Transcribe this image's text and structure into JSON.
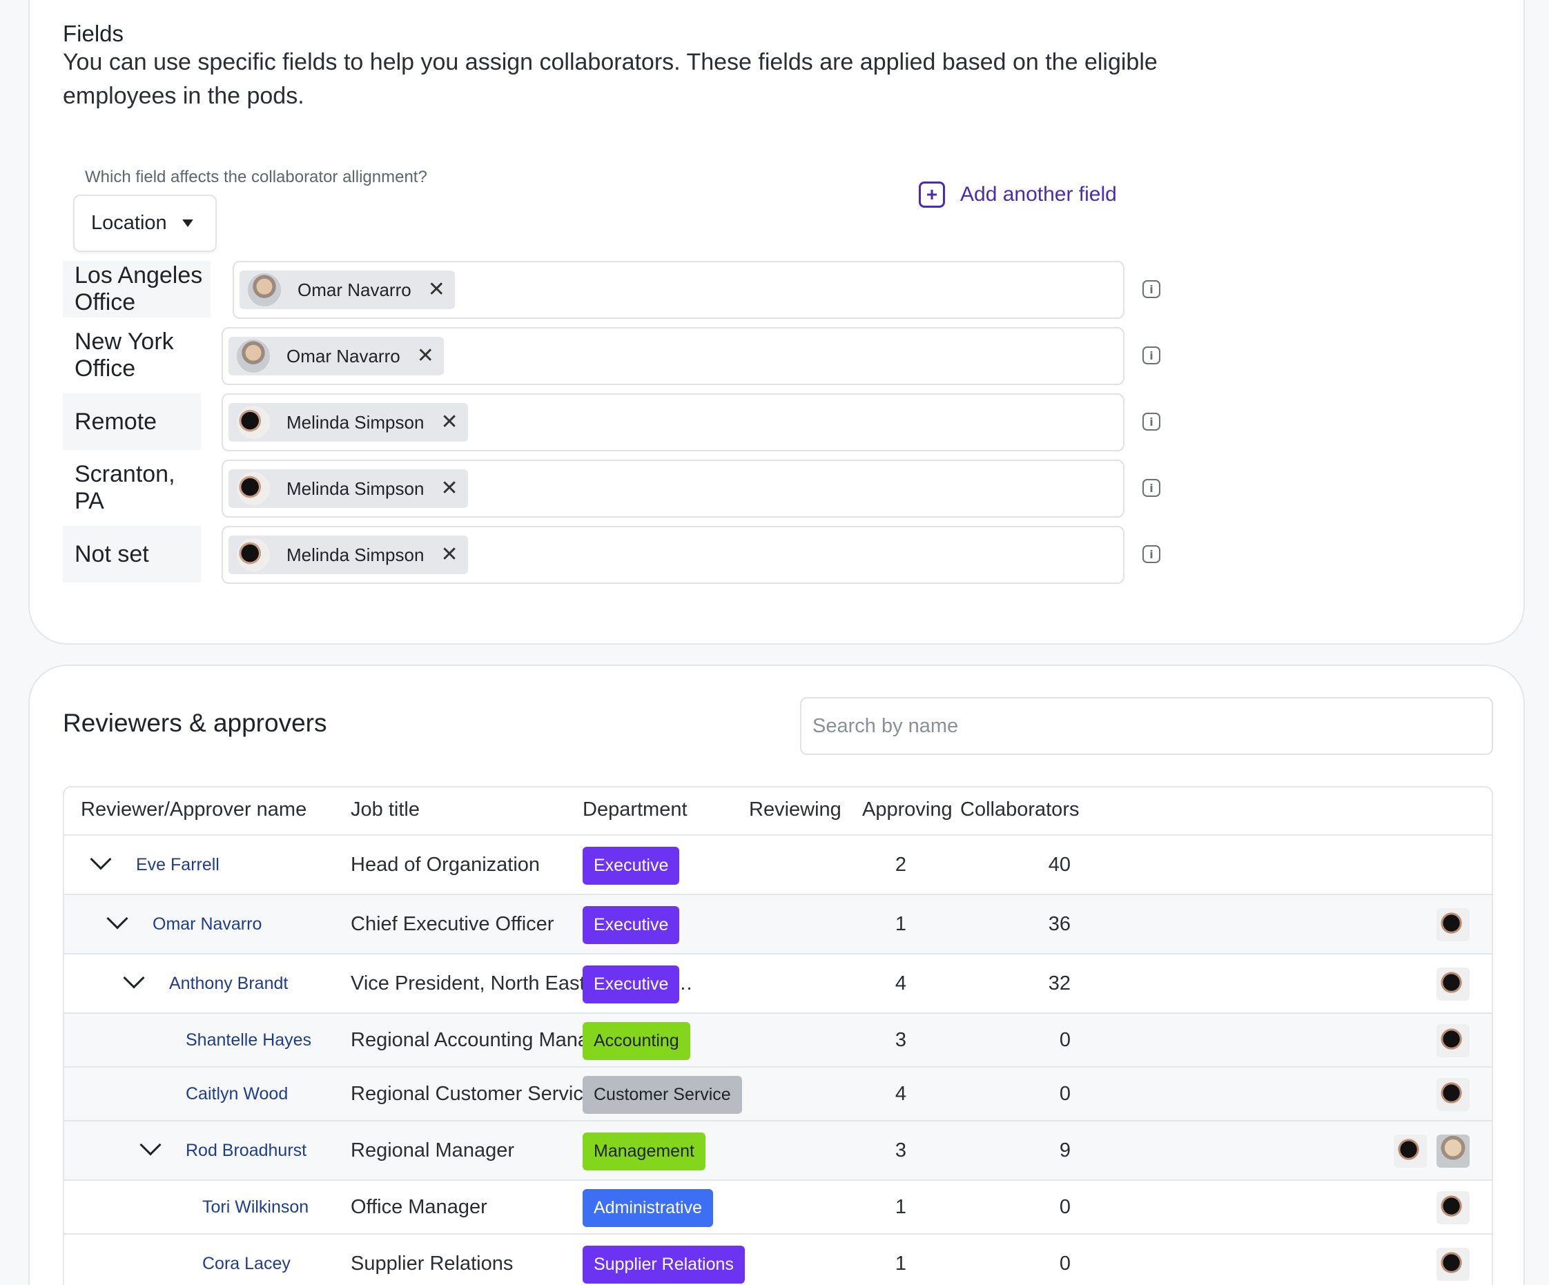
{
  "fields": {
    "title": "Fields",
    "description": "You can use specific fields to help you assign collaborators. These fields are applied based on the eligible employees in the pods.",
    "question": "Which field affects the collaborator allignment?",
    "selected_field": "Location",
    "add_field_label": "Add another field",
    "locations": [
      {
        "label": "Los Angeles Office",
        "collaborator": "Omar Navarro",
        "avatar": "omar"
      },
      {
        "label": "New York Office",
        "collaborator": "Omar Navarro",
        "avatar": "omar"
      },
      {
        "label": "Remote",
        "collaborator": "Melinda Simpson",
        "avatar": "melinda"
      },
      {
        "label": "Scranton, PA",
        "collaborator": "Melinda Simpson",
        "avatar": "melinda"
      },
      {
        "label": "Not set",
        "collaborator": "Melinda Simpson",
        "avatar": "melinda"
      }
    ]
  },
  "reviewers": {
    "title": "Reviewers & approvers",
    "search_placeholder": "Search by name",
    "columns": {
      "name": "Reviewer/Approver name",
      "job": "Job title",
      "department": "Department",
      "reviewing": "Reviewing",
      "approving": "Approving",
      "collaborators": "Collaborators"
    },
    "rows": [
      {
        "name": "Eve Farrell",
        "job": "Head of Organization",
        "department": "Executive",
        "reviewing": "2",
        "approving": "40",
        "expandable": true,
        "level": 0,
        "collaborators": []
      },
      {
        "name": "Omar Navarro",
        "job": "Chief Executive Officer",
        "department": "Executive",
        "reviewing": "1",
        "approving": "36",
        "expandable": true,
        "level": 1,
        "collaborators": [
          "melinda"
        ]
      },
      {
        "name": "Anthony Brandt",
        "job": "Vice President, North East Region &…",
        "department": "Executive",
        "reviewing": "4",
        "approving": "32",
        "expandable": true,
        "level": 2,
        "collaborators": [
          "melinda"
        ]
      },
      {
        "name": "Shantelle Hayes",
        "job": "Regional Accounting Manager",
        "department": "Accounting",
        "reviewing": "3",
        "approving": "0",
        "expandable": false,
        "level": 3,
        "collaborators": [
          "melinda"
        ]
      },
      {
        "name": "Caitlyn Wood",
        "job": "Regional Customer Service Manager",
        "department": "Customer Service",
        "reviewing": "4",
        "approving": "0",
        "expandable": false,
        "level": 3,
        "collaborators": [
          "melinda"
        ]
      },
      {
        "name": "Rod Broadhurst",
        "job": "Regional Manager",
        "department": "Management",
        "reviewing": "3",
        "approving": "9",
        "expandable": true,
        "level": 3,
        "collaborators": [
          "melinda",
          "omar"
        ]
      },
      {
        "name": "Tori Wilkinson",
        "job": "Office Manager",
        "department": "Administrative",
        "reviewing": "1",
        "approving": "0",
        "expandable": false,
        "level": 4,
        "collaborators": [
          "melinda"
        ]
      },
      {
        "name": "Cora Lacey",
        "job": "Supplier Relations",
        "department": "Supplier Relations",
        "reviewing": "1",
        "approving": "0",
        "expandable": false,
        "level": 4,
        "collaborators": [
          "melinda"
        ]
      }
    ]
  },
  "department_colors": {
    "Executive": {
      "bg": "#6d33f2",
      "fg": "#ffffff"
    },
    "Accounting": {
      "bg": "#84d61c",
      "fg": "#1f2328"
    },
    "Customer Service": {
      "bg": "#b7bbc2",
      "fg": "#1f2328"
    },
    "Management": {
      "bg": "#84d61c",
      "fg": "#1f2328"
    },
    "Administrative": {
      "bg": "#3d6ff5",
      "fg": "#ffffff"
    },
    "Supplier Relations": {
      "bg": "#6d33f2",
      "fg": "#ffffff"
    }
  },
  "colors": {
    "accent": "#4b2ab8",
    "link": "#1f3d8f"
  }
}
